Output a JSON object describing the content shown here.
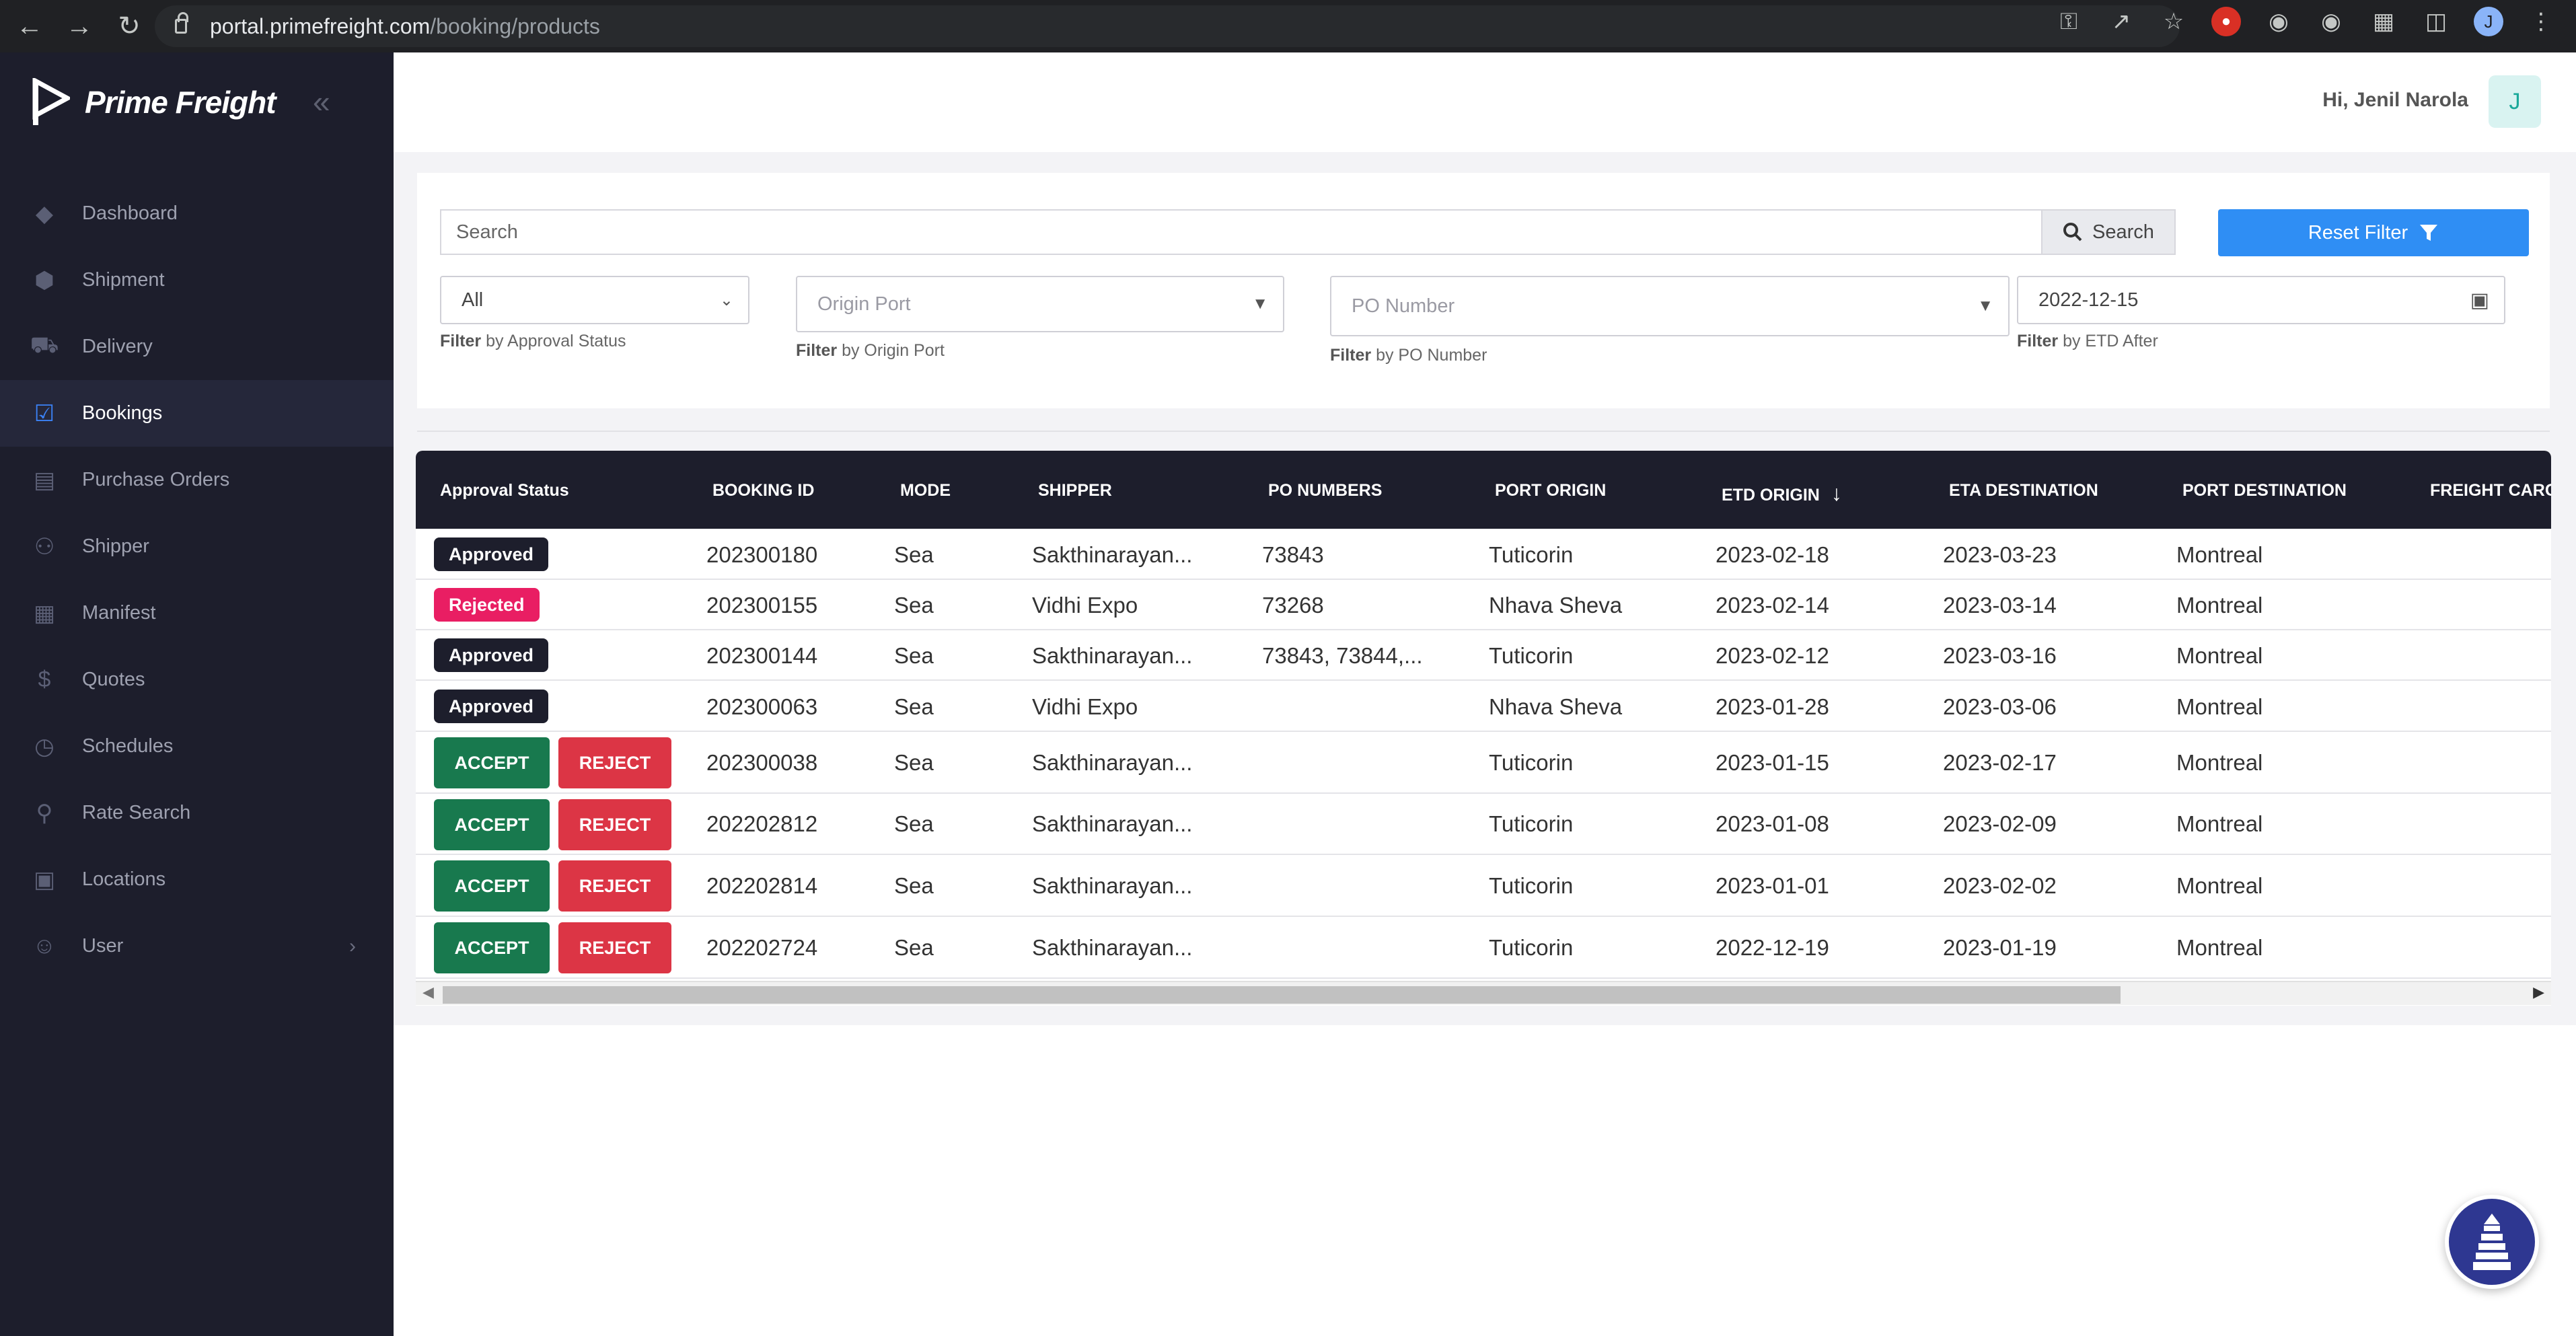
{
  "browser": {
    "url_host": "portal.primefreight.com",
    "url_path": "/booking/products",
    "profile_initial": "J"
  },
  "sidebar": {
    "brand": "Prime Freight",
    "items": [
      {
        "label": "Dashboard",
        "icon": "diamond-icon"
      },
      {
        "label": "Shipment",
        "icon": "box-icon"
      },
      {
        "label": "Delivery",
        "icon": "truck-icon"
      },
      {
        "label": "Bookings",
        "icon": "checkbox-icon",
        "active": true
      },
      {
        "label": "Purchase Orders",
        "icon": "document-icon"
      },
      {
        "label": "Shipper",
        "icon": "users-icon"
      },
      {
        "label": "Manifest",
        "icon": "file-icon"
      },
      {
        "label": "Quotes",
        "icon": "dollar-icon"
      },
      {
        "label": "Schedules",
        "icon": "clock-icon"
      },
      {
        "label": "Rate Search",
        "icon": "search-icon"
      },
      {
        "label": "Locations",
        "icon": "building-icon"
      },
      {
        "label": "User",
        "icon": "user-circle-icon"
      }
    ]
  },
  "header": {
    "greeting": "Hi, Jenil Narola",
    "avatar_initial": "J"
  },
  "filters": {
    "search_placeholder": "Search",
    "search_button": "Search",
    "reset_button": "Reset Filter",
    "approval_status": {
      "value": "All",
      "label_bold": "Filter",
      "label_rest": " by Approval Status"
    },
    "origin_port": {
      "placeholder": "Origin Port",
      "label_bold": "Filter",
      "label_rest": " by Origin Port"
    },
    "po_number": {
      "placeholder": "PO Number",
      "label_bold": "Filter",
      "label_rest": " by PO Number"
    },
    "etd_after": {
      "value": "2022-12-15",
      "label_bold": "Filter",
      "label_rest": " by ETD After"
    }
  },
  "table": {
    "columns": [
      "Approval Status",
      "BOOKING ID",
      "MODE",
      "SHIPPER",
      "PO NUMBERS",
      "PORT ORIGIN",
      "ETD ORIGIN",
      "ETA DESTINATION",
      "PORT DESTINATION",
      "FREIGHT CARG"
    ],
    "accept_label": "ACCEPT",
    "reject_label": "REJECT",
    "rows": [
      {
        "status": "Approved",
        "booking_id": "202300180",
        "mode": "Sea",
        "shipper": "Sakthinarayan...",
        "po": "73843",
        "origin": "Tuticorin",
        "etd": "2023-02-18",
        "eta": "2023-03-23",
        "dest": "Montreal"
      },
      {
        "status": "Rejected",
        "booking_id": "202300155",
        "mode": "Sea",
        "shipper": "Vidhi Expo",
        "po": "73268",
        "origin": "Nhava Sheva",
        "etd": "2023-02-14",
        "eta": "2023-03-14",
        "dest": "Montreal"
      },
      {
        "status": "Approved",
        "booking_id": "202300144",
        "mode": "Sea",
        "shipper": "Sakthinarayan...",
        "po": "73843, 73844,...",
        "origin": "Tuticorin",
        "etd": "2023-02-12",
        "eta": "2023-03-16",
        "dest": "Montreal"
      },
      {
        "status": "Approved",
        "booking_id": "202300063",
        "mode": "Sea",
        "shipper": "Vidhi Expo",
        "po": "",
        "origin": "Nhava Sheva",
        "etd": "2023-01-28",
        "eta": "2023-03-06",
        "dest": "Montreal"
      },
      {
        "status": "pending",
        "booking_id": "202300038",
        "mode": "Sea",
        "shipper": "Sakthinarayan...",
        "po": "",
        "origin": "Tuticorin",
        "etd": "2023-01-15",
        "eta": "2023-02-17",
        "dest": "Montreal"
      },
      {
        "status": "pending",
        "booking_id": "202202812",
        "mode": "Sea",
        "shipper": "Sakthinarayan...",
        "po": "",
        "origin": "Tuticorin",
        "etd": "2023-01-08",
        "eta": "2023-02-09",
        "dest": "Montreal"
      },
      {
        "status": "pending",
        "booking_id": "202202814",
        "mode": "Sea",
        "shipper": "Sakthinarayan...",
        "po": "",
        "origin": "Tuticorin",
        "etd": "2023-01-01",
        "eta": "2023-02-02",
        "dest": "Montreal"
      },
      {
        "status": "pending",
        "booking_id": "202202724",
        "mode": "Sea",
        "shipper": "Sakthinarayan...",
        "po": "",
        "origin": "Tuticorin",
        "etd": "2022-12-19",
        "eta": "2023-01-19",
        "dest": "Montreal"
      }
    ]
  },
  "colors": {
    "sidebar_bg": "#1d1e2c",
    "accent": "#2f8ef4",
    "accept": "#18794e",
    "reject": "#dc3545",
    "rejected_badge": "#e91e63"
  }
}
